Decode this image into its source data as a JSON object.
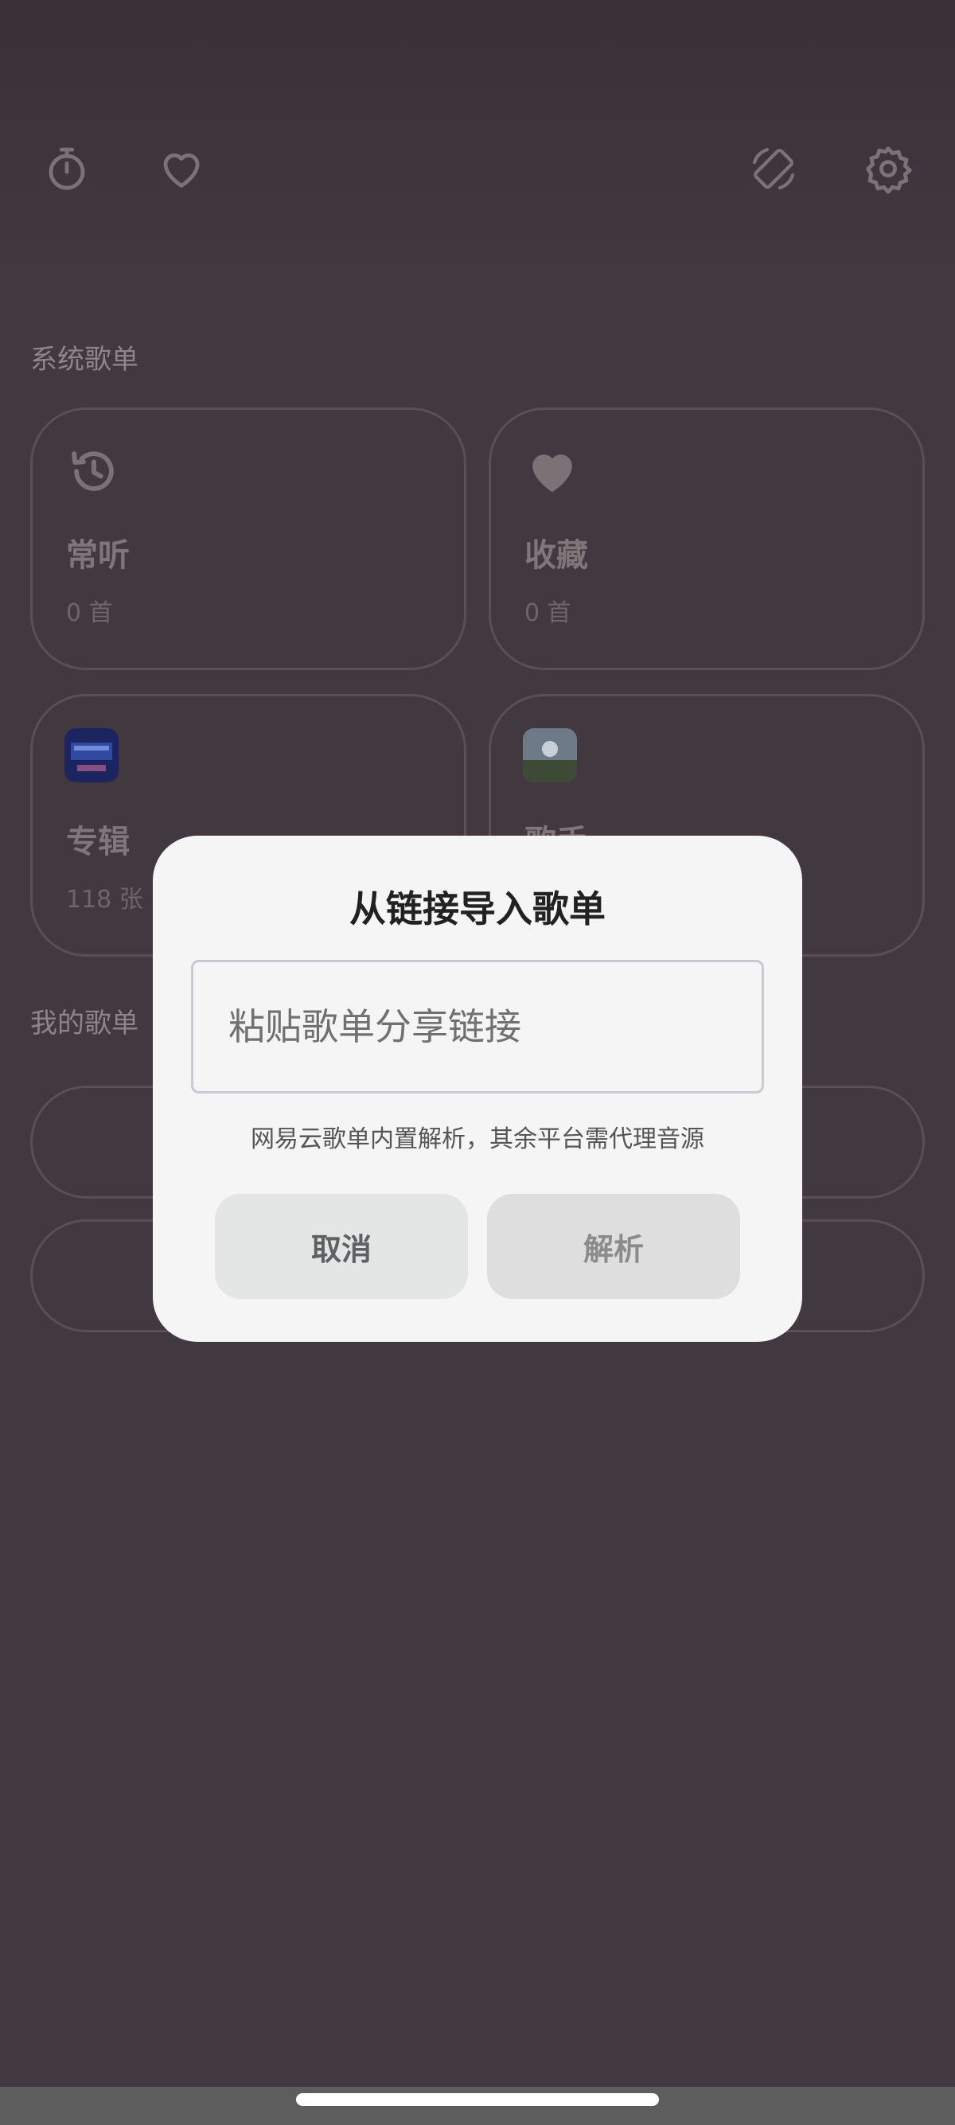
{
  "app": {
    "sections": {
      "system_playlists": "系统歌单",
      "my_playlists": "我的歌单"
    },
    "cards": [
      {
        "title": "常听",
        "count": "0 首",
        "icon": "history-icon"
      },
      {
        "title": "收藏",
        "count": "0 首",
        "icon": "heart-filled-icon"
      },
      {
        "title": "专辑",
        "count": "118 张",
        "icon": "album-cover"
      },
      {
        "title": "歌手",
        "count": "",
        "icon": "artist-cover"
      }
    ],
    "top_icons": [
      "timer-icon",
      "heart-outline-icon",
      "screen-rotate-icon",
      "gear-icon"
    ]
  },
  "dialog": {
    "title": "从链接导入歌单",
    "input_placeholder": "粘贴歌单分享链接",
    "input_value": "",
    "hint": "网易云歌单内置解析，其余平台需代理音源",
    "cancel_label": "取消",
    "parse_label": "解析"
  },
  "colors": {
    "background": "#42383f",
    "dialog_bg": "#f5f5f5",
    "cancel_bg": "#e4e6e6",
    "parse_bg": "#dedede"
  }
}
